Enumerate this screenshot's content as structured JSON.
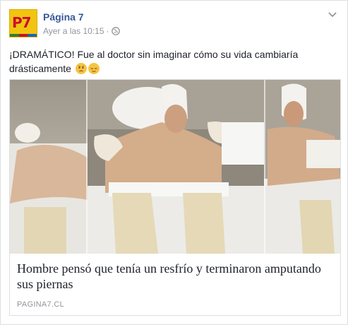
{
  "post": {
    "page_name": "Página 7",
    "timestamp": "Ayer a las 10:15",
    "separator": "·",
    "message": "¡DRAMÁTICO! Fue al doctor sin imaginar cómo su vida cambiaría drásticamente",
    "message_emojis": [
      "anxious-face",
      "relieved-face"
    ]
  },
  "avatar": {
    "text": "P7"
  },
  "link": {
    "title": "Hombre pensó que tenía un resfrío y terminaron amputando sus piernas",
    "domain": "PAGINA7.CL"
  },
  "colors": {
    "page_name": "#365899",
    "meta": "#90949c",
    "avatar_bg": "#f1c40f",
    "avatar_text": "#c8102e"
  }
}
